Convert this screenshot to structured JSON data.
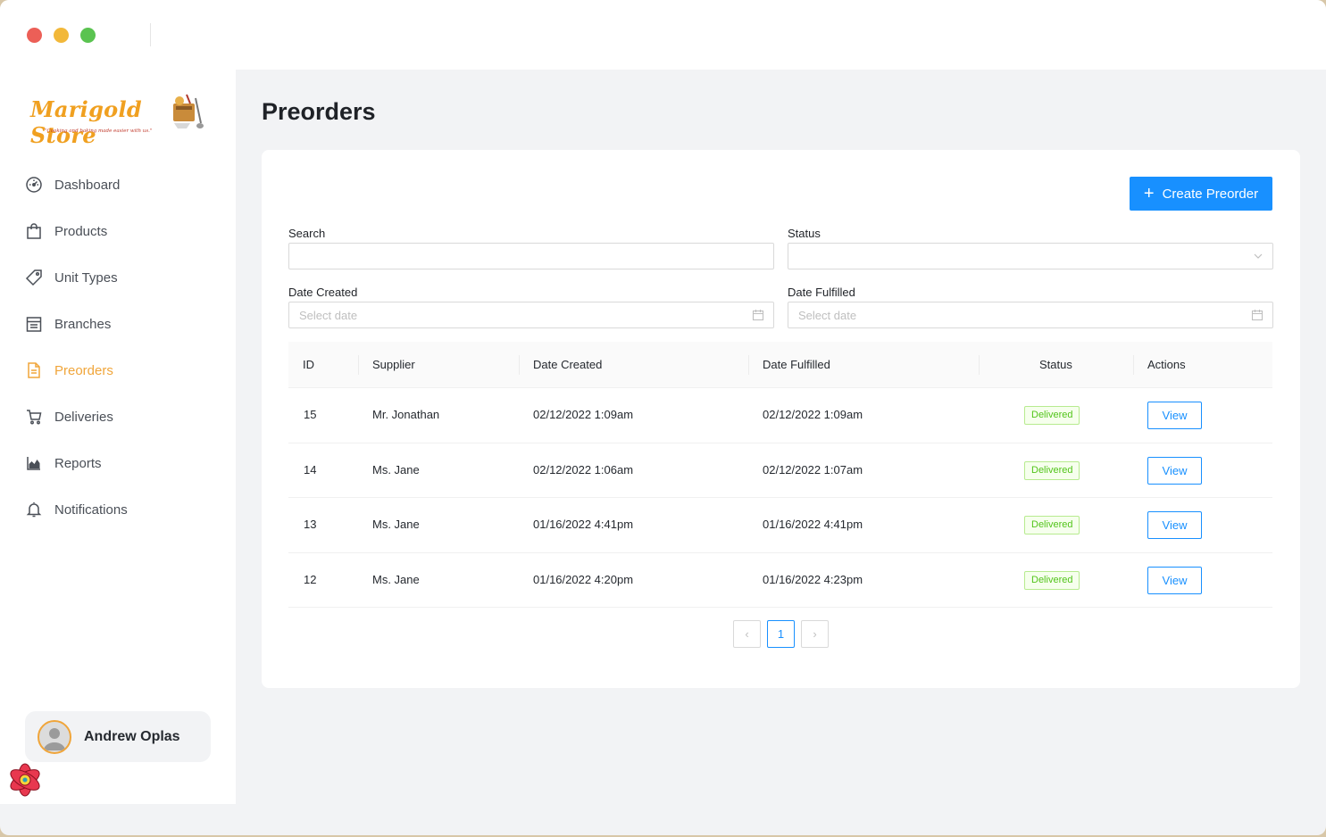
{
  "window": {
    "traffic_lights": [
      "close",
      "minimize",
      "maximize"
    ]
  },
  "brand": {
    "name": "Marigold Store",
    "tagline": "\"Cooking and baking made easier with us.\""
  },
  "sidebar": {
    "items": [
      {
        "label": "Dashboard",
        "icon": "dashboard-icon",
        "active": false
      },
      {
        "label": "Products",
        "icon": "shopping-bag-icon",
        "active": false
      },
      {
        "label": "Unit Types",
        "icon": "tag-icon",
        "active": false
      },
      {
        "label": "Branches",
        "icon": "shop-icon",
        "active": false
      },
      {
        "label": "Preorders",
        "icon": "file-text-icon",
        "active": true
      },
      {
        "label": "Deliveries",
        "icon": "shopping-cart-icon",
        "active": false
      },
      {
        "label": "Reports",
        "icon": "area-chart-icon",
        "active": false
      },
      {
        "label": "Notifications",
        "icon": "bell-icon",
        "active": false
      }
    ],
    "user": {
      "name": "Andrew Oplas"
    }
  },
  "page": {
    "title": "Preorders",
    "create_button": "Create Preorder"
  },
  "filters": {
    "search_label": "Search",
    "search_value": "",
    "status_label": "Status",
    "status_value": "",
    "date_created_label": "Date Created",
    "date_created_placeholder": "Select date",
    "date_fulfilled_label": "Date Fulfilled",
    "date_fulfilled_placeholder": "Select date"
  },
  "table": {
    "columns": [
      "ID",
      "Supplier",
      "Date Created",
      "Date Fulfilled",
      "Status",
      "Actions"
    ],
    "rows": [
      {
        "id": "15",
        "supplier": "Mr. Jonathan",
        "created": "02/12/2022 1:09am",
        "fulfilled": "02/12/2022 1:09am",
        "status": "Delivered",
        "action": "View"
      },
      {
        "id": "14",
        "supplier": "Ms. Jane",
        "created": "02/12/2022 1:06am",
        "fulfilled": "02/12/2022 1:07am",
        "status": "Delivered",
        "action": "View"
      },
      {
        "id": "13",
        "supplier": "Ms. Jane",
        "created": "01/16/2022 4:41pm",
        "fulfilled": "01/16/2022 4:41pm",
        "status": "Delivered",
        "action": "View"
      },
      {
        "id": "12",
        "supplier": "Ms. Jane",
        "created": "01/16/2022 4:20pm",
        "fulfilled": "01/16/2022 4:23pm",
        "status": "Delivered",
        "action": "View"
      }
    ]
  },
  "pagination": {
    "prev": "‹",
    "current": "1",
    "next": "›"
  },
  "colors": {
    "primary": "#1890ff",
    "accent": "#f0a53a",
    "success": "#52c41a"
  }
}
